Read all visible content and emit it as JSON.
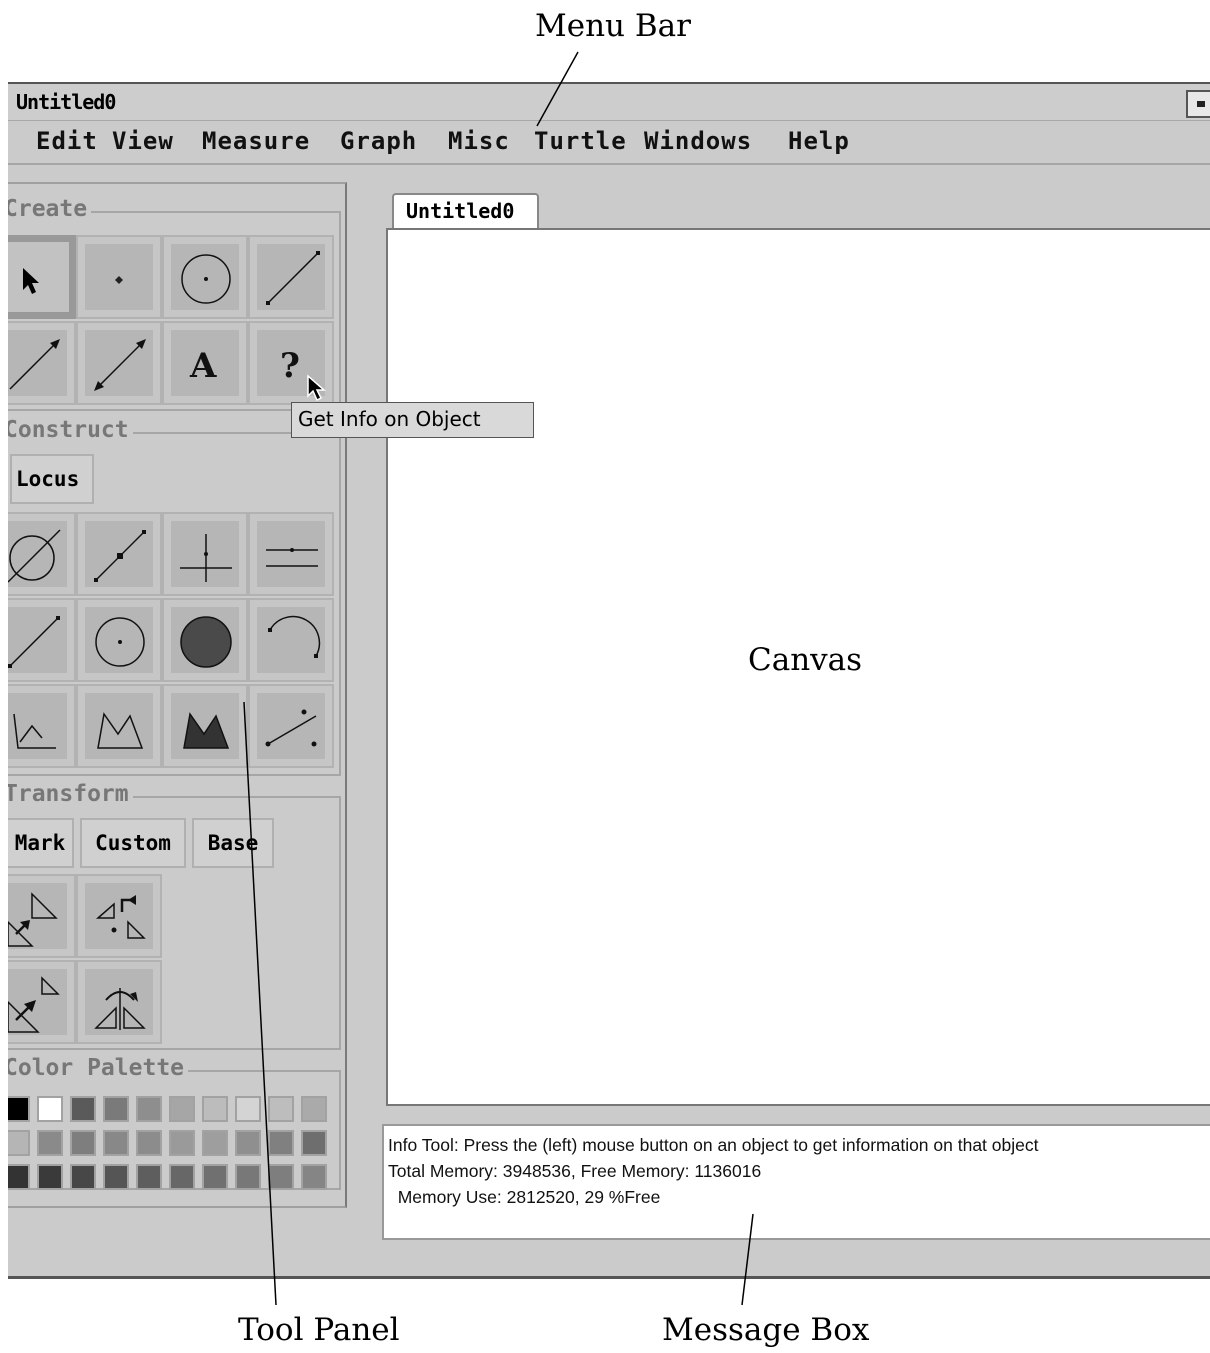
{
  "annotations": {
    "menu_bar": "Menu Bar",
    "canvas": "Canvas",
    "tool_panel": "Tool Panel",
    "message_box": "Message Box"
  },
  "window": {
    "title": "Untitled0"
  },
  "menu": [
    "Edit",
    "View",
    "Measure",
    "Graph",
    "Misc",
    "Turtle",
    "Windows",
    "Help"
  ],
  "tool_panel": {
    "create": {
      "label": "Create",
      "tools": [
        "arrow-select-icon",
        "point-icon",
        "circle-icon",
        "segment-icon",
        "ray-icon",
        "line-icon",
        "text-icon",
        "info-icon"
      ]
    },
    "construct": {
      "label": "Construct",
      "locus_label": "Locus",
      "tools": [
        "intersection-icon",
        "midpoint-icon",
        "perpendicular-icon",
        "parallel-icon",
        "segment-construct-icon",
        "circle-by-center-icon",
        "filled-circle-icon",
        "arc-icon",
        "polygon-open-icon",
        "polygon-icon",
        "filled-polygon-icon",
        "locus-points-icon"
      ]
    },
    "transform": {
      "label": "Transform",
      "buttons": [
        "Mark",
        "Custom",
        "Base"
      ],
      "tools": [
        "translate-icon",
        "rotate-icon",
        "dilate-icon",
        "reflect-icon"
      ]
    },
    "color_palette": {
      "label": "Color Palette",
      "rows": [
        [
          "#000000",
          "#ffffff",
          "#5a5a5a",
          "#7a7a7a",
          "#8e8e8e",
          "#a6a6a6",
          "#bcbcbc",
          "#d4d4d4",
          "#bdbdbd",
          "#aaaaaa"
        ],
        [
          "#b5b5b5",
          "#8a8a8a",
          "#7e7e7e",
          "#888888",
          "#8c8c8c",
          "#9a9a9a",
          "#9e9e9e",
          "#8f8f8f",
          "#808080",
          "#6e6e6e"
        ],
        [
          "#333333",
          "#3a3a3a",
          "#474747",
          "#555555",
          "#5e5e5e",
          "#676767",
          "#707070",
          "#787878",
          "#7e7e7e",
          "#858585"
        ]
      ]
    }
  },
  "tooltip": "Get Info on Object",
  "canvas_tab": "Untitled0",
  "message_box": {
    "line1": "Info Tool:  Press the (left) mouse button on an object to get information on that object",
    "line2": "Total Memory: 3948536, Free Memory: 1136016",
    "line3": "  Memory Use: 2812520, 29 %Free"
  }
}
